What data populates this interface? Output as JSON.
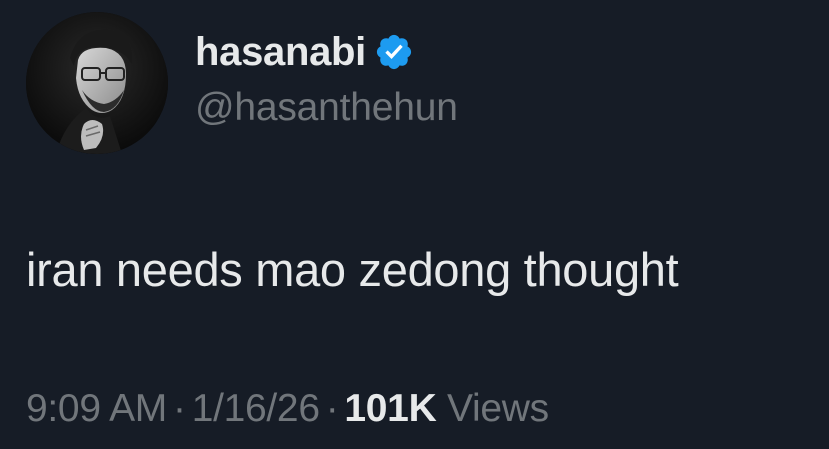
{
  "author": {
    "display_name": "hasanabi",
    "handle": "@hasanthehun",
    "verified": true,
    "verified_icon": "verified-badge-icon",
    "avatar": "profile-photo"
  },
  "tweet": {
    "text": "iran needs mao zedong thought"
  },
  "meta": {
    "time": "9:09 AM",
    "separator": "·",
    "date": "1/16/26",
    "views_count": "101K",
    "views_label": "Views"
  },
  "colors": {
    "background": "#161c26",
    "primary_text": "#e7e9ea",
    "secondary_text": "#71767b",
    "verified_blue": "#1d9bf0"
  }
}
